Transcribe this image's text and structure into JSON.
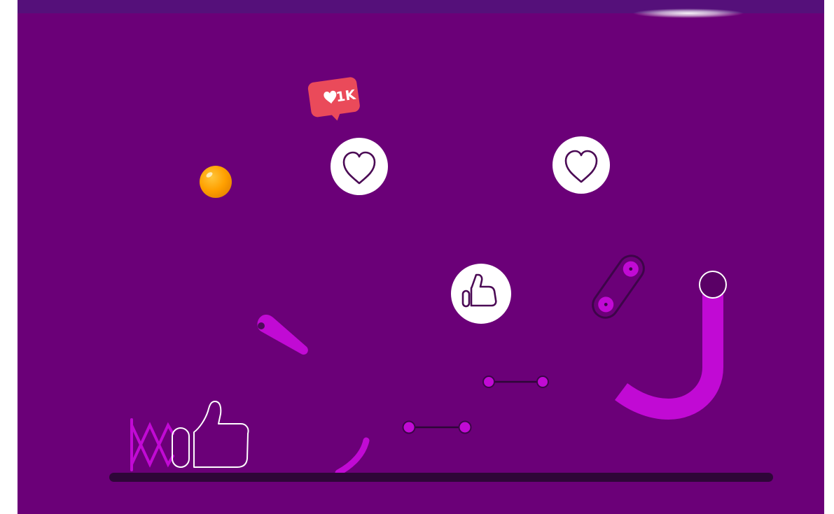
{
  "game": {
    "like_badge": {
      "icon": "heart-icon",
      "count": "1K",
      "color": "#ea4a5a"
    },
    "colors": {
      "background": "#6b0078",
      "top_bar": "#55107a",
      "accent": "#c10ad4",
      "floor": "#2e0638",
      "ball": "#ffa000",
      "bumper_fill": "#ffffff",
      "icon_stroke": "#4b0a55"
    },
    "bumpers": [
      {
        "kind": "heart",
        "icon": "heart-outline-icon"
      },
      {
        "kind": "heart",
        "icon": "heart-outline-icon"
      },
      {
        "kind": "thumbs-up",
        "icon": "thumbs-up-icon"
      }
    ],
    "launcher": {
      "icon": "thumbs-up-outline-icon",
      "spring": "scissor-spring"
    }
  }
}
